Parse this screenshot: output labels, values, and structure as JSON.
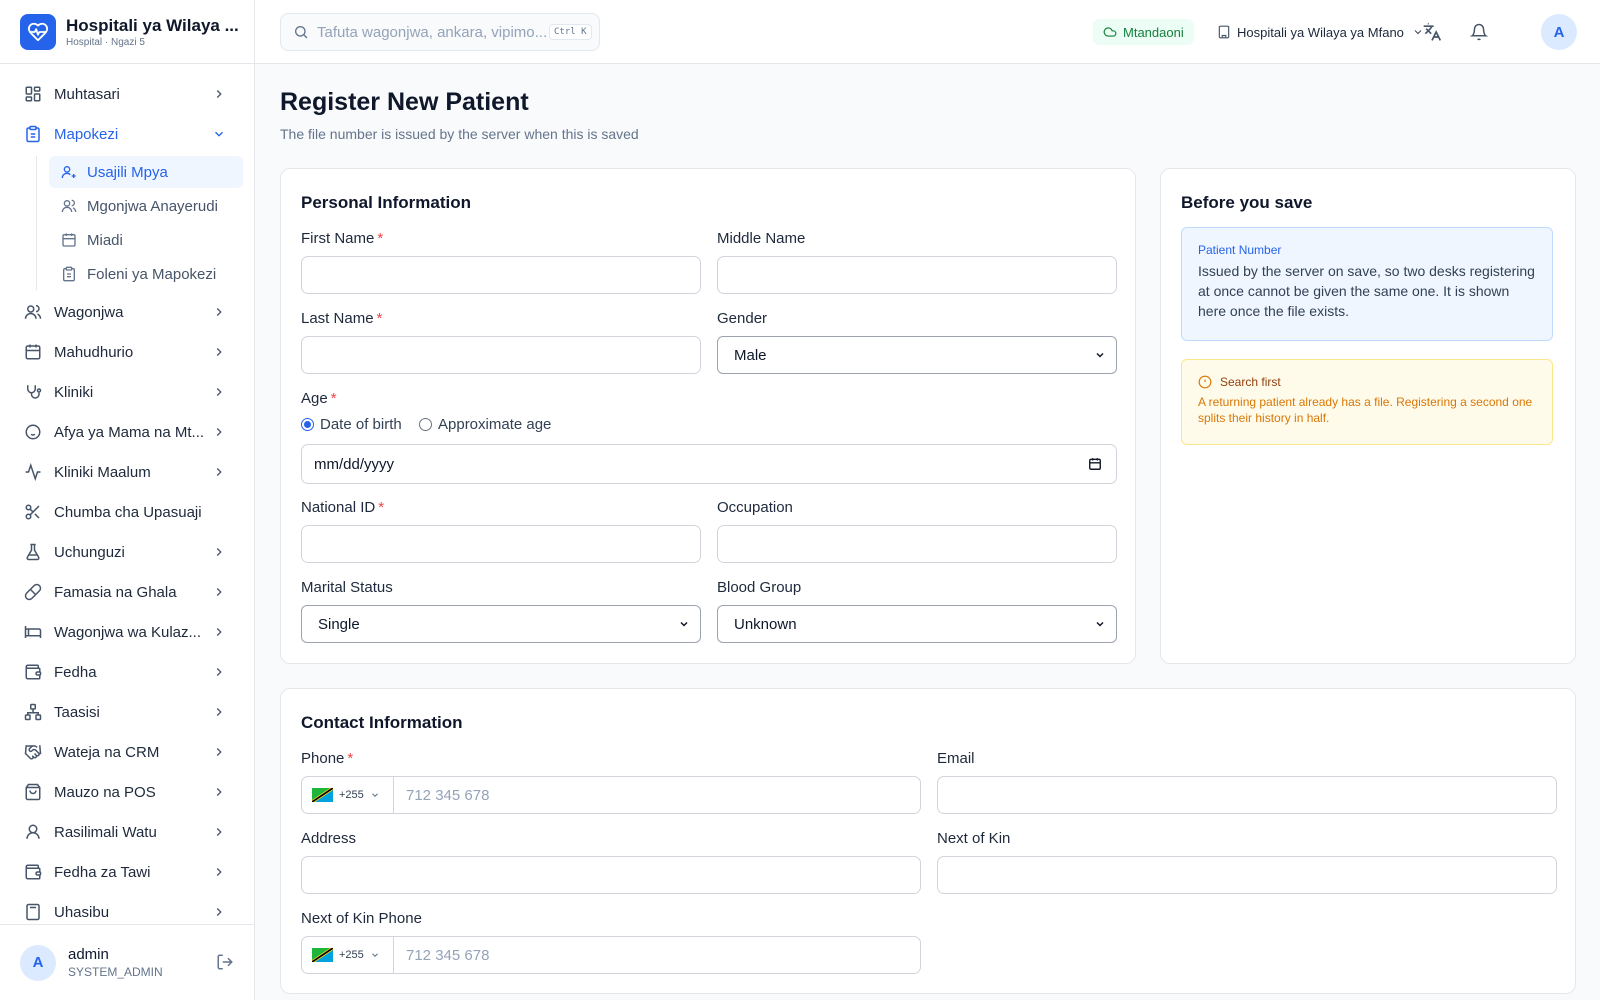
{
  "app": {
    "name": "Hospitali ya Wilaya ...",
    "subtitle": "Hospital · Ngazi 5"
  },
  "search": {
    "placeholder": "Tafuta wagonjwa, ankara, vipimo...",
    "shortcut": "Ctrl K"
  },
  "header": {
    "network_status": "Mtandaoni",
    "facility": "Hospitali ya Wilaya ya Mfano",
    "avatar": "A"
  },
  "sidebar": {
    "items": [
      {
        "label": "Muhtasari",
        "icon": "dashboard-icon"
      },
      {
        "label": "Mapokezi",
        "icon": "clipboard-icon",
        "expanded": true,
        "children": [
          {
            "label": "Usajili Mpya",
            "icon": "user-plus-icon",
            "active": true
          },
          {
            "label": "Mgonjwa Anayerudi",
            "icon": "users-icon"
          },
          {
            "label": "Miadi",
            "icon": "calendar-icon"
          },
          {
            "label": "Foleni ya Mapokezi",
            "icon": "clipboard-list-icon"
          }
        ]
      },
      {
        "label": "Wagonjwa",
        "icon": "users-icon"
      },
      {
        "label": "Mahudhurio",
        "icon": "calendar-icon"
      },
      {
        "label": "Kliniki",
        "icon": "stethoscope-icon"
      },
      {
        "label": "Afya ya Mama na Mt...",
        "icon": "baby-icon"
      },
      {
        "label": "Kliniki Maalum",
        "icon": "activity-icon"
      },
      {
        "label": "Chumba cha Upasuaji",
        "icon": "scissors-icon"
      },
      {
        "label": "Uchunguzi",
        "icon": "flask-icon"
      },
      {
        "label": "Famasia na Ghala",
        "icon": "pill-icon"
      },
      {
        "label": "Wagonjwa wa Kulaz...",
        "icon": "bed-icon"
      },
      {
        "label": "Fedha",
        "icon": "wallet-icon"
      },
      {
        "label": "Taasisi",
        "icon": "network-icon"
      },
      {
        "label": "Wateja na CRM",
        "icon": "handshake-icon"
      },
      {
        "label": "Mauzo na POS",
        "icon": "shopping-bag-icon"
      },
      {
        "label": "Rasilimali Watu",
        "icon": "user-icon"
      },
      {
        "label": "Fedha za Tawi",
        "icon": "wallet-icon"
      },
      {
        "label": "Uhasibu",
        "icon": "calculator-icon"
      }
    ]
  },
  "user": {
    "initial": "A",
    "name": "admin",
    "role": "SYSTEM_ADMIN"
  },
  "page": {
    "title": "Register New Patient",
    "subtitle": "The file number is issued by the server when this is saved"
  },
  "personal": {
    "title": "Personal Information",
    "first_name": "First Name",
    "middle_name": "Middle Name",
    "last_name": "Last Name",
    "gender": "Gender",
    "gender_value": "Male",
    "age": "Age",
    "age_mode_dob": "Date of birth",
    "age_mode_approx": "Approximate age",
    "dob_placeholder": "mm/dd/yyyy",
    "national_id": "National ID",
    "occupation": "Occupation",
    "marital_status": "Marital Status",
    "marital_value": "Single",
    "blood_group": "Blood Group",
    "blood_value": "Unknown"
  },
  "save_notes": {
    "title": "Before you save",
    "patient_number_title": "Patient Number",
    "patient_number_body": "Issued by the server on save, so two desks registering at once cannot be given the same one. It is shown here once the file exists.",
    "search_first_title": "Search first",
    "search_first_body": "A returning patient already has a file. Registering a second one splits their history in half."
  },
  "contact": {
    "title": "Contact Information",
    "phone": "Phone",
    "email": "Email",
    "address": "Address",
    "next_of_kin": "Next of Kin",
    "next_of_kin_phone": "Next of Kin Phone",
    "country_code": "+255",
    "phone_placeholder": "712 345 678"
  },
  "colors": {
    "accent": "#2563eb",
    "required": "#ef4444",
    "online": "#15803d"
  }
}
